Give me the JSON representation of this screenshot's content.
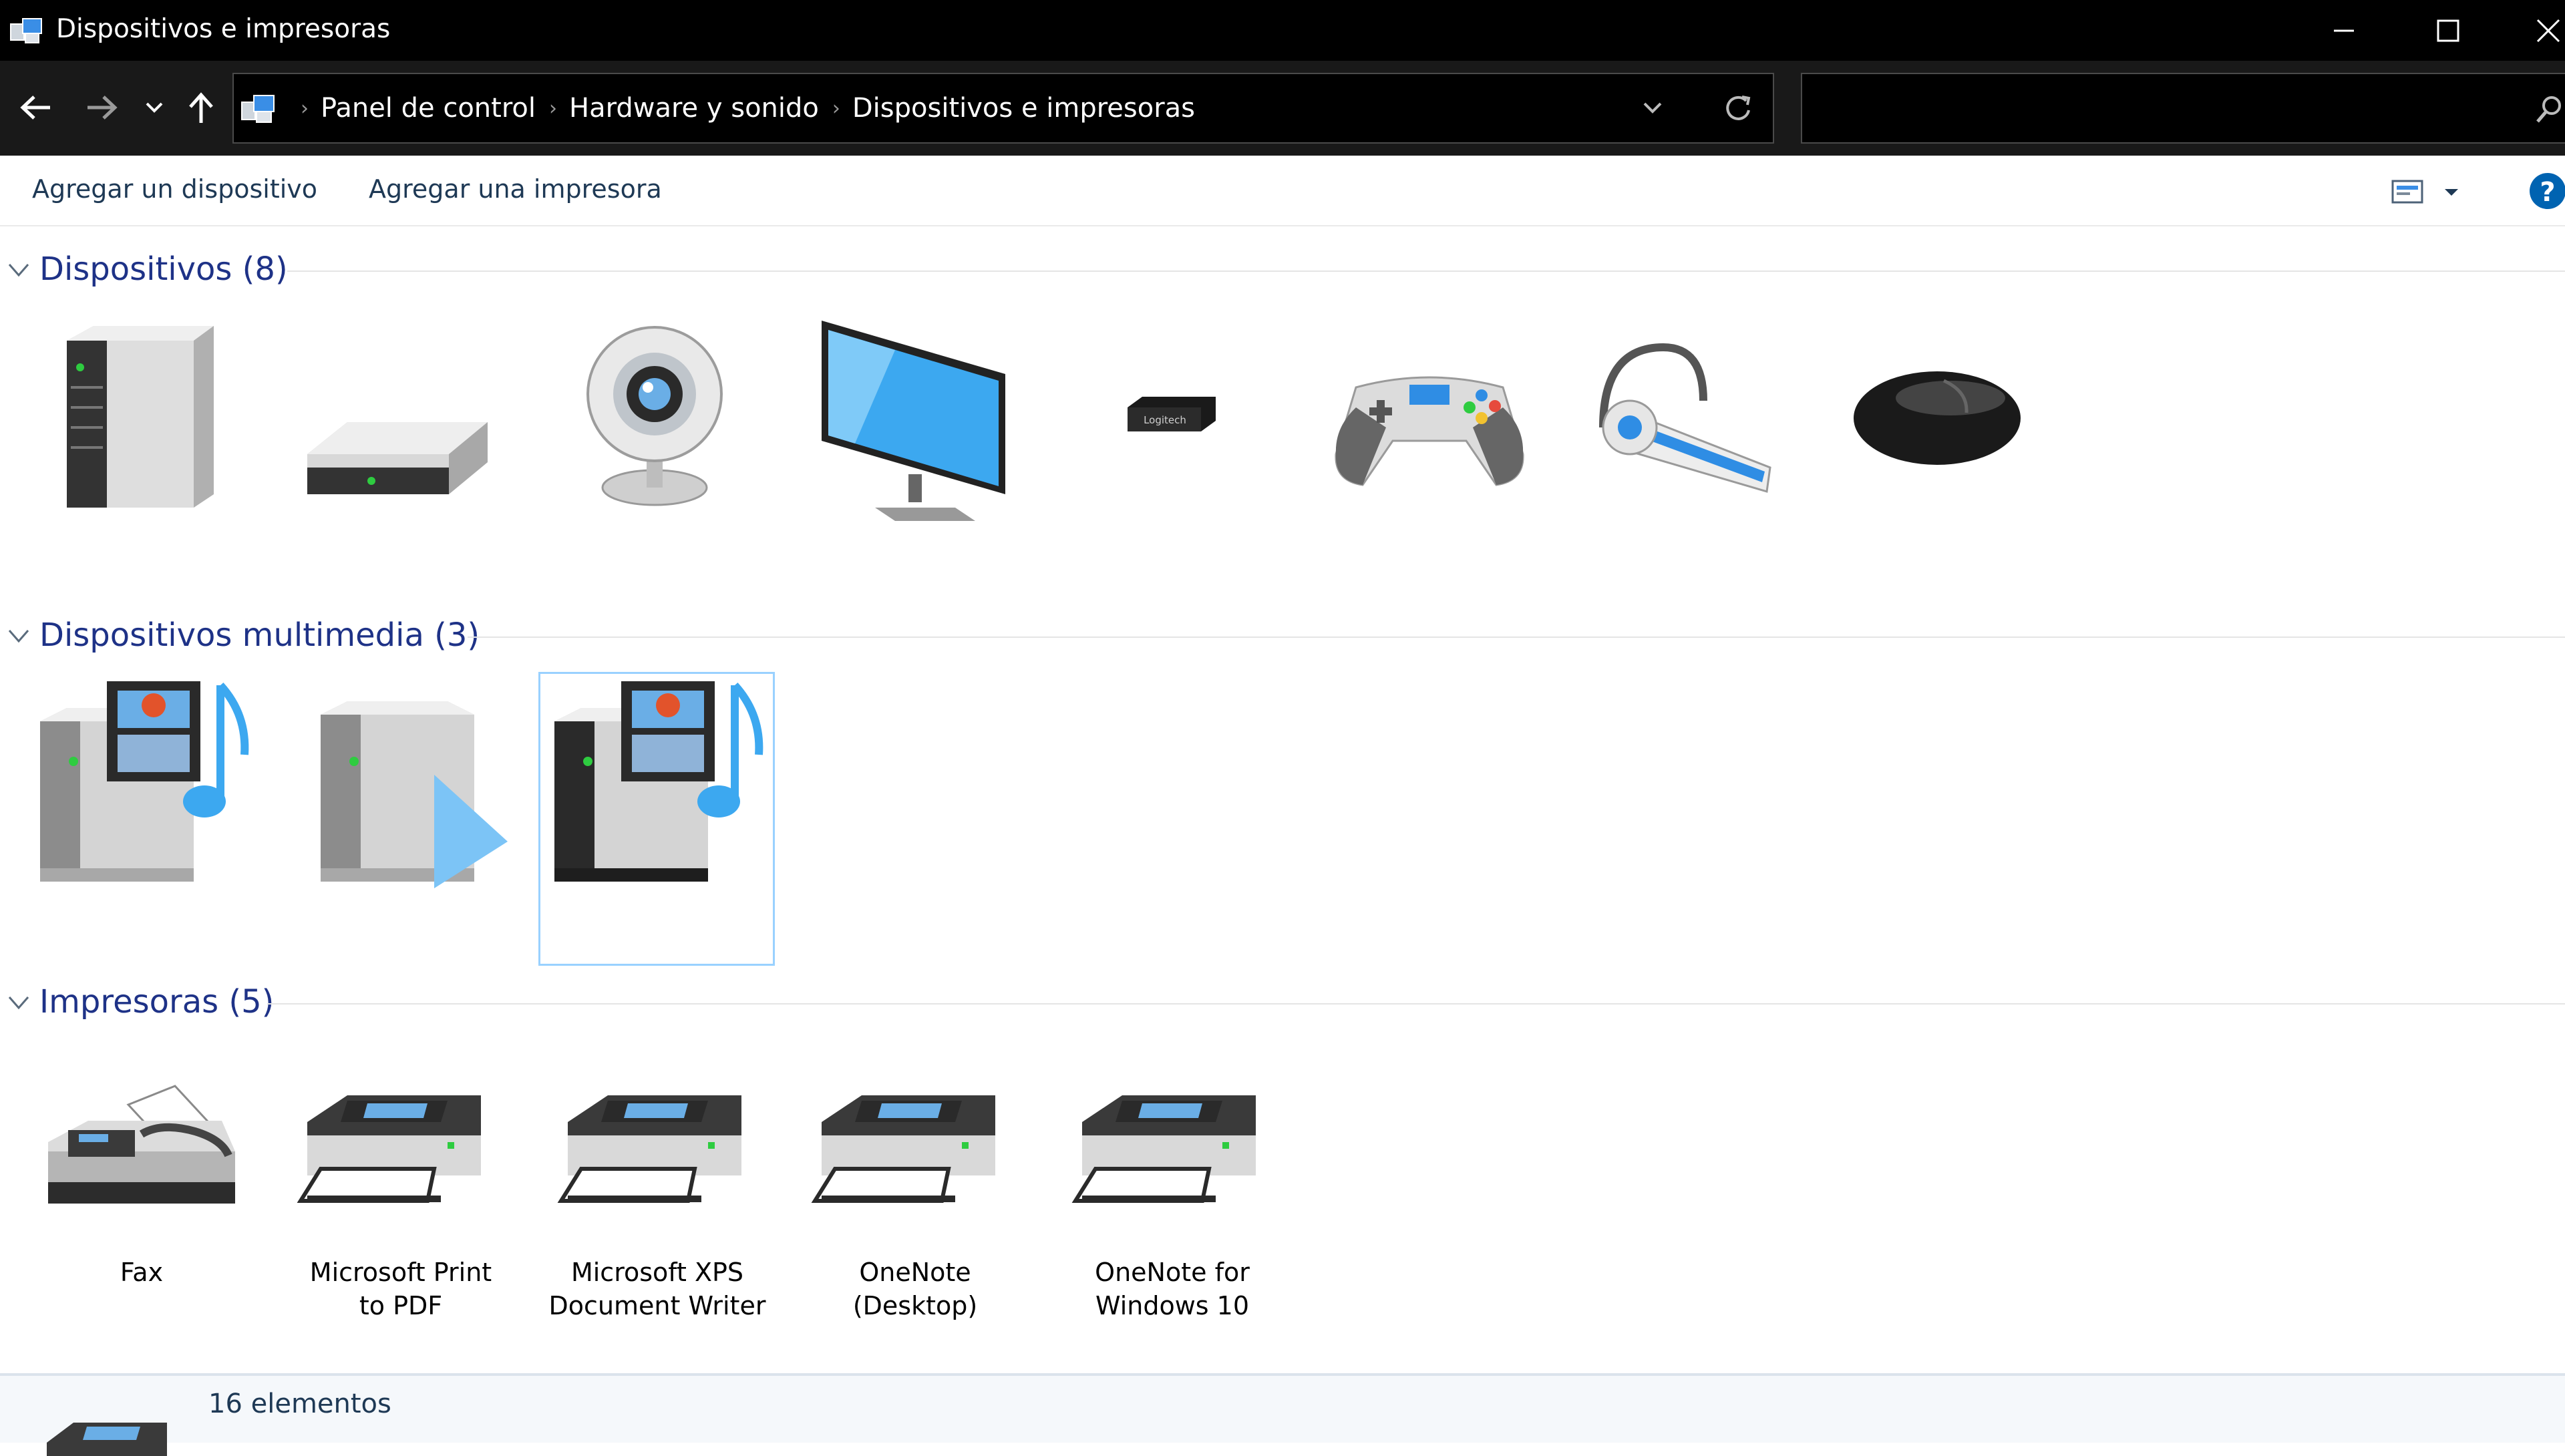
{
  "window": {
    "title": "Dispositivos e impresoras"
  },
  "address_bar": {
    "breadcrumbs": [
      "Panel de control",
      "Hardware y sonido",
      "Dispositivos e impresoras"
    ],
    "separator": "›"
  },
  "search": {
    "value": "",
    "placeholder": ""
  },
  "toolbar": {
    "add_device": "Agregar un dispositivo",
    "add_printer": "Agregar una impresora"
  },
  "groups": {
    "devices": {
      "title": "Dispositivos (8)",
      "icons": [
        "computer-tower-icon",
        "external-drive-icon",
        "webcam-icon",
        "monitor-icon",
        "usb-receiver-icon",
        "gamepad-icon",
        "bluetooth-headset-icon",
        "mouse-icon"
      ],
      "usb_receiver_brand": "Logitech"
    },
    "multimedia": {
      "title": "Dispositivos multimedia (3)",
      "icons": [
        "media-server-icon",
        "media-renderer-icon",
        "media-server-icon"
      ],
      "selected_index": 2
    },
    "printers": {
      "title": "Impresoras (5)",
      "items": [
        {
          "label": "Fax",
          "icon": "fax-icon"
        },
        {
          "label": "Microsoft Print\nto PDF",
          "icon": "printer-icon"
        },
        {
          "label": "Microsoft XPS\nDocument Writer",
          "icon": "printer-icon"
        },
        {
          "label": "OneNote\n(Desktop)",
          "icon": "printer-icon"
        },
        {
          "label": "OneNote for\nWindows 10",
          "icon": "printer-icon"
        }
      ]
    }
  },
  "status_bar": {
    "count": "16 elementos"
  },
  "colors": {
    "title_bar": "#000000",
    "nav_bar": "#191919",
    "group_header": "#1e3287",
    "command_text": "#1e3955",
    "selection_border": "#99d1ff",
    "help_blue": "#0063b1"
  }
}
